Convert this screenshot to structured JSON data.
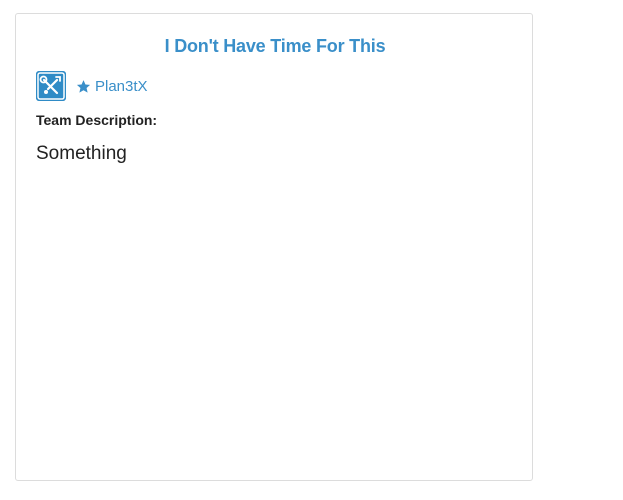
{
  "team": {
    "title": "I Don't Have Time For This",
    "members": [
      {
        "name": "Plan3tX",
        "avatar_icon": "wrench-tools-avatar-icon",
        "leader_icon": "star-icon"
      }
    ],
    "description_label": "Team Description:",
    "description": "Something"
  },
  "colors": {
    "accent": "#3a8fc9",
    "avatar_bg": "#2f8bc6",
    "border": "#dcdcdc",
    "text": "#222222"
  }
}
